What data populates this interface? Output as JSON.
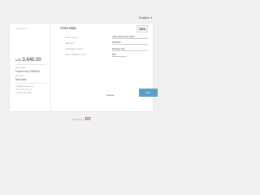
{
  "header": {
    "language": "English"
  },
  "summary": {
    "total_label": "Total amount",
    "currency": "USD",
    "amount": "3,645.00",
    "order_label": "Description",
    "order_value": "Payment for 0000011",
    "merchant_label": "Merchant",
    "merchant_value": "Merchant",
    "contact_lines": [
      "info@example.com",
      "www.example.com",
      "+1 555 000 0000"
    ]
  },
  "form": {
    "title": "Card data",
    "card_brand": "VISA",
    "fields": [
      {
        "label": "Card number *",
        "value": "4011 0101 0101 0007"
      },
      {
        "label": "Valid thru *",
        "value": "05/2023"
      },
      {
        "label": "Cardholder's name *",
        "value": "Nombre Tarj"
      },
      {
        "label": "Card verification value *",
        "value": "000"
      }
    ],
    "cancel_label": "Cancel",
    "pay_label": "Pay"
  },
  "footer": {
    "powered_by": "Powered by",
    "brand": "DC"
  },
  "colors": {
    "accent": "#5b9fc7",
    "cancel": "#c0392b",
    "brand": "#d62b2b"
  }
}
